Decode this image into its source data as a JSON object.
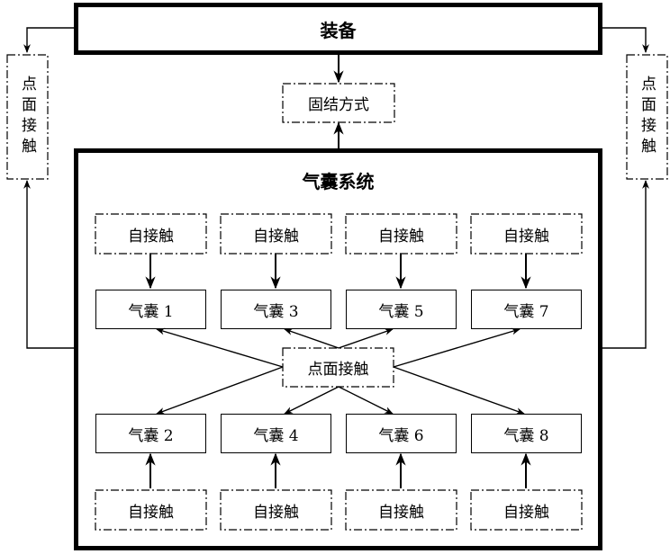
{
  "equipment": {
    "label": "装备"
  },
  "fastening": {
    "label": "固结方式"
  },
  "side_contacts": {
    "left": {
      "label": "点面接触"
    },
    "right": {
      "label": "点面接触"
    }
  },
  "airbag_system": {
    "title": "气囊系统",
    "center_contact": {
      "label": "点面接触"
    },
    "top_row": [
      {
        "self_contact": "自接触",
        "airbag": "气囊 1"
      },
      {
        "self_contact": "自接触",
        "airbag": "气囊 3"
      },
      {
        "self_contact": "自接触",
        "airbag": "气囊 5"
      },
      {
        "self_contact": "自接触",
        "airbag": "气囊 7"
      }
    ],
    "bottom_row": [
      {
        "self_contact": "自接触",
        "airbag": "气囊 2"
      },
      {
        "self_contact": "自接触",
        "airbag": "气囊 4"
      },
      {
        "self_contact": "自接触",
        "airbag": "气囊 6"
      },
      {
        "self_contact": "自接触",
        "airbag": "气囊 8"
      }
    ]
  }
}
